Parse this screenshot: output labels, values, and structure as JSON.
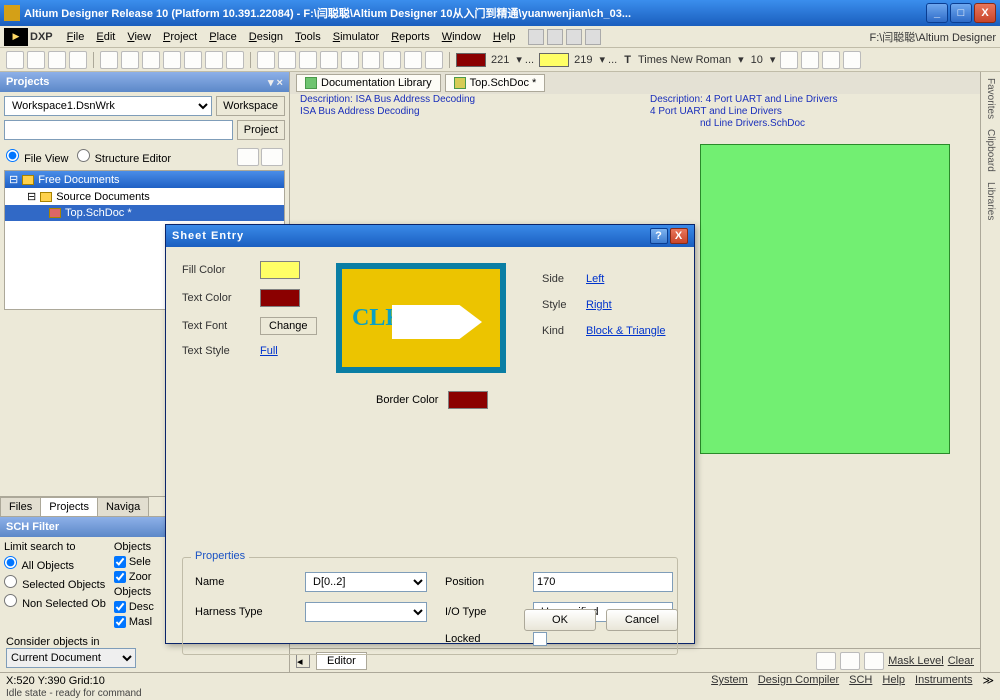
{
  "title": "Altium Designer Release 10 (Platform 10.391.22084) - F:\\闫聪聪\\Altium Designer 10从入门到精通\\yuanwenjian\\ch_03...",
  "menubar": {
    "dxp": "DXP",
    "items": [
      "File",
      "Edit",
      "View",
      "Project",
      "Place",
      "Design",
      "Tools",
      "Simulator",
      "Reports",
      "Window",
      "Help"
    ],
    "path": "F:\\闫聪聪\\Altium Designer"
  },
  "toolbar": {
    "num1": "221",
    "num2": "219",
    "font": "Times New Roman",
    "size": "10"
  },
  "projects": {
    "header": "Projects",
    "workspace": "Workspace1.DsnWrk",
    "ws_btn": "Workspace",
    "proj_btn": "Project",
    "radio1": "File View",
    "radio2": "Structure Editor",
    "tree_root": "Free Documents",
    "tree_src": "Source Documents",
    "tree_doc": "Top.SchDoc *",
    "tabs": [
      "Files",
      "Projects",
      "Naviga"
    ]
  },
  "sch": {
    "header": "SCH Filter",
    "limit": "Limit search to",
    "r1": "All Objects",
    "r2": "Selected Objects",
    "r3": "Non Selected Ob",
    "col2": "Objects",
    "c1": "Sele",
    "c2": "Zoor",
    "c3": "Desc",
    "c4": "Masl",
    "consider": "Consider objects in",
    "scope": "Current Document"
  },
  "doc_tabs": {
    "t1": "Documentation Library",
    "t2": "Top.SchDoc *"
  },
  "canvas": {
    "d1a": "Description: ISA Bus Address Decoding",
    "d1b": "ISA Bus Address Decoding",
    "d2a": "Description: 4 Port UART and Line Drivers",
    "d2b": "4 Port UART and Line Drivers",
    "d2c": "nd Line Drivers.SchDoc"
  },
  "editor_tabs": {
    "tab": "Editor",
    "mask": "Mask Level",
    "clear": "Clear"
  },
  "status": {
    "coord": "X:520 Y:390  Grid:10",
    "idle": "Idle state - ready for command",
    "links": [
      "System",
      "Design Compiler",
      "SCH",
      "Help",
      "Instruments"
    ]
  },
  "rstrip": [
    "Favorites",
    "Clipboard",
    "Libraries"
  ],
  "dialog": {
    "title": "Sheet Entry",
    "fill": "Fill Color",
    "text": "Text Color",
    "font": "Text Font",
    "change": "Change",
    "style_lbl": "Text Style",
    "style": "Full",
    "border": "Border Color",
    "side_lbl": "Side",
    "side": "Left",
    "rstyle_lbl": "Style",
    "rstyle": "Right",
    "kind_lbl": "Kind",
    "kind": "Block & Triangle",
    "clk": "CLK",
    "props": "Properties",
    "name_lbl": "Name",
    "name": "D[0..2]",
    "pos_lbl": "Position",
    "pos": "170",
    "harness_lbl": "Harness Type",
    "io_lbl": "I/O Type",
    "io": "Unspecified",
    "locked": "Locked",
    "ok": "OK",
    "cancel": "Cancel"
  }
}
